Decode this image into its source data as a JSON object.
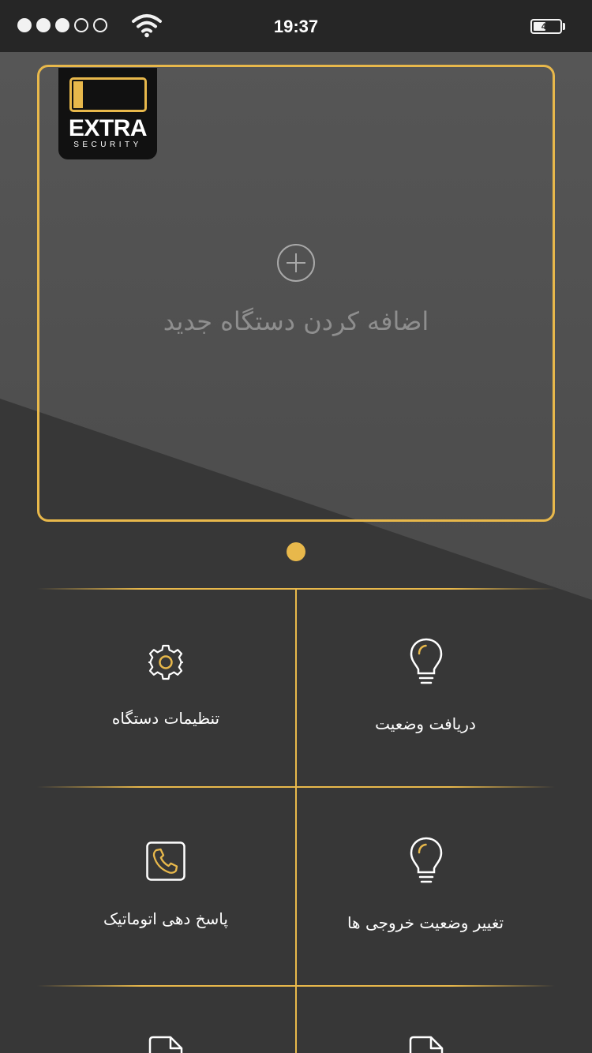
{
  "status_bar": {
    "signal_dots": [
      "filled",
      "filled",
      "filled",
      "empty",
      "empty"
    ],
    "time": "19:37",
    "battery_level": "46",
    "battery_fraction": 0.46
  },
  "brand": {
    "name": "EXTRA",
    "tagline": "SECURITY"
  },
  "device_card": {
    "add_device_label": "اضافه کردن دستگاه جدید",
    "icon": "plus-circle-icon"
  },
  "pager": {
    "total": 1,
    "active": 1
  },
  "menu": [
    {
      "label": "دریافت وضعیت",
      "icon": "lightbulb-icon"
    },
    {
      "label": "تنظیمات دستگاه",
      "icon": "gear-icon"
    },
    {
      "label": "تغییر وضعیت خروجی ها",
      "icon": "lightbulb-icon"
    },
    {
      "label": "پاسخ دهی اتوماتیک",
      "icon": "phone-icon"
    },
    {
      "label": "",
      "icon": "document-icon"
    },
    {
      "label": "",
      "icon": "document-icon"
    }
  ],
  "colors": {
    "accent": "#e8b84b",
    "background": "#373737",
    "status_bar": "#262626",
    "muted_text": "#8e8e8e"
  }
}
